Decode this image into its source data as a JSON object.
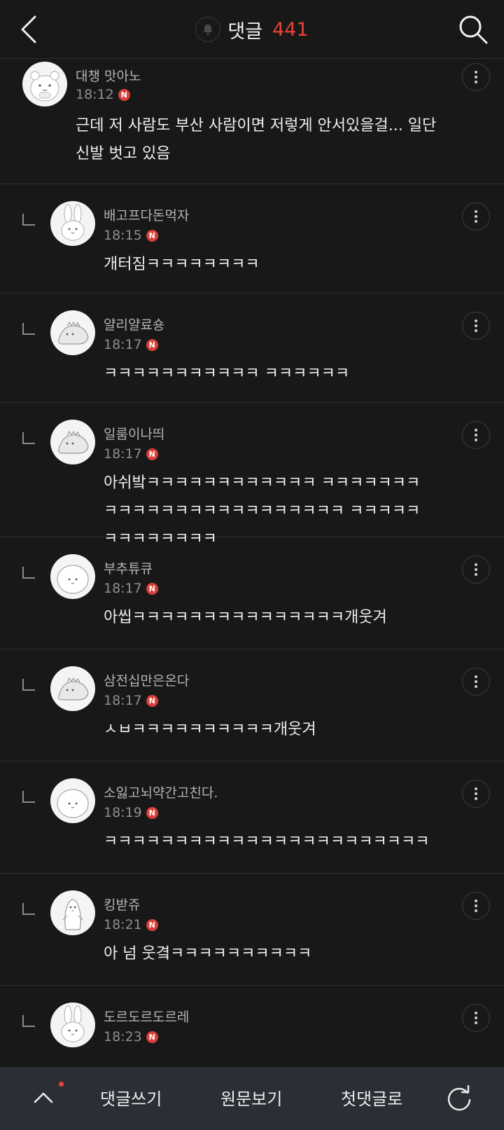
{
  "header": {
    "title": "댓글",
    "count": "441",
    "icons": [
      "back-icon",
      "bell-icon",
      "search-icon"
    ]
  },
  "badge_label": "N",
  "comments": [
    {
      "nickname": "대챙 맛아노",
      "time": "18:12",
      "text": "근데 저 사람도 부산 사람이면 저렇게 안서있을걸... 일단 신발 벗고 있음",
      "reply": false,
      "avatar": "hamster-avatar"
    },
    {
      "nickname": "배고프다돈먹자",
      "time": "18:15",
      "text": "개터짐ㅋㅋㅋㅋㅋㅋㅋㅋ",
      "reply": true,
      "avatar": "rabbit-avatar"
    },
    {
      "nickname": "얄리얄료숑",
      "time": "18:17",
      "text": "ㅋㅋㅋㅋㅋㅋㅋㅋㅋㅋㅋ ㅋㅋㅋㅋㅋㅋ",
      "reply": true,
      "avatar": "dino-avatar"
    },
    {
      "nickname": "일룸이나띄",
      "time": "18:17",
      "text": "아쉬밬ㅋㅋㅋㅋㅋㅋㅋㅋㅋㅋㅋㅋ ㅋㅋㅋㅋㅋㅋㅋㅋㅋㅋㅋㅋㅋㅋㅋㅋㅋㅋㅋㅋㅋㅋㅋㅋ ㅋㅋㅋㅋㅋㅋㅋㅋㅋㅋㅋㅋㅋ",
      "reply": true,
      "avatar": "dino-avatar"
    },
    {
      "nickname": "부추튜큐",
      "time": "18:17",
      "text": "아씹ㅋㅋㅋㅋㅋㅋㅋㅋㅋㅋㅋㅋㅋㅋㅋ개웃겨",
      "reply": true,
      "avatar": "blob-avatar"
    },
    {
      "nickname": "삼전십만은온다",
      "time": "18:17",
      "text": "ㅅㅂㅋㅋㅋㅋㅋㅋㅋㅋㅋㅋ개웃겨",
      "reply": true,
      "avatar": "dino-avatar"
    },
    {
      "nickname": "소잃고뇌약간고친다.",
      "time": "18:19",
      "text": "ㅋㅋㅋㅋㅋㅋㅋㅋㅋㅋㅋㅋㅋㅋㅋㅋㅋㅋㅋㅋㅋㅋㅋ",
      "reply": true,
      "avatar": "blob-avatar"
    },
    {
      "nickname": "킹받쥬",
      "time": "18:21",
      "text": "아 넘 웃곀ㅋㅋㅋㅋㅋㅋㅋㅋㅋㅋ",
      "reply": true,
      "avatar": "penguin-avatar"
    },
    {
      "nickname": "도르도르도르레",
      "time": "18:23",
      "text": "",
      "reply": true,
      "avatar": "rabbit-avatar"
    }
  ],
  "bottom_bar": {
    "write": "댓글쓰기",
    "original": "원문보기",
    "first": "첫댓글로",
    "icons": [
      "chevron-up-icon",
      "refresh-icon"
    ]
  }
}
